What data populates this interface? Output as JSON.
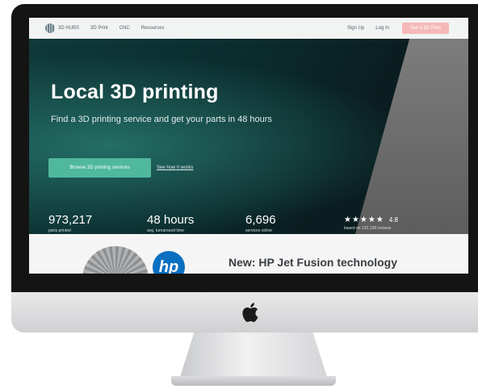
{
  "nav": {
    "brand": "3D HUBS",
    "items": [
      "3D Print",
      "CNC",
      "Resources"
    ],
    "signup": "Sign Up",
    "login": "Log In",
    "cta": "Get a 3D Print"
  },
  "hero": {
    "title": "Local 3D printing",
    "subtitle": "Find a 3D printing service and get your parts in 48 hours",
    "primary_button": "Browse 3D printing services",
    "secondary_link": "See how it works",
    "stats": [
      {
        "value": "973,217",
        "label": "parts printed"
      },
      {
        "value": "48 hours",
        "label": "avg. turnaround time"
      },
      {
        "value": "6,696",
        "label": "services online"
      }
    ],
    "rating": {
      "stars": "★★★★★",
      "value": "4.8",
      "label": "based on 120,108 reviews"
    }
  },
  "section2": {
    "title": "New: HP Jet Fusion technology",
    "hp_logo": "hp"
  },
  "icons": {
    "apple": "apple-icon",
    "brand": "brand-logo-icon",
    "stars": "star-icon"
  },
  "colors": {
    "accent": "#4fb89d",
    "cta_nav": "#f4b9b6",
    "hero_dark": "#0f3a3a",
    "hp_blue": "#0b6fc2"
  }
}
